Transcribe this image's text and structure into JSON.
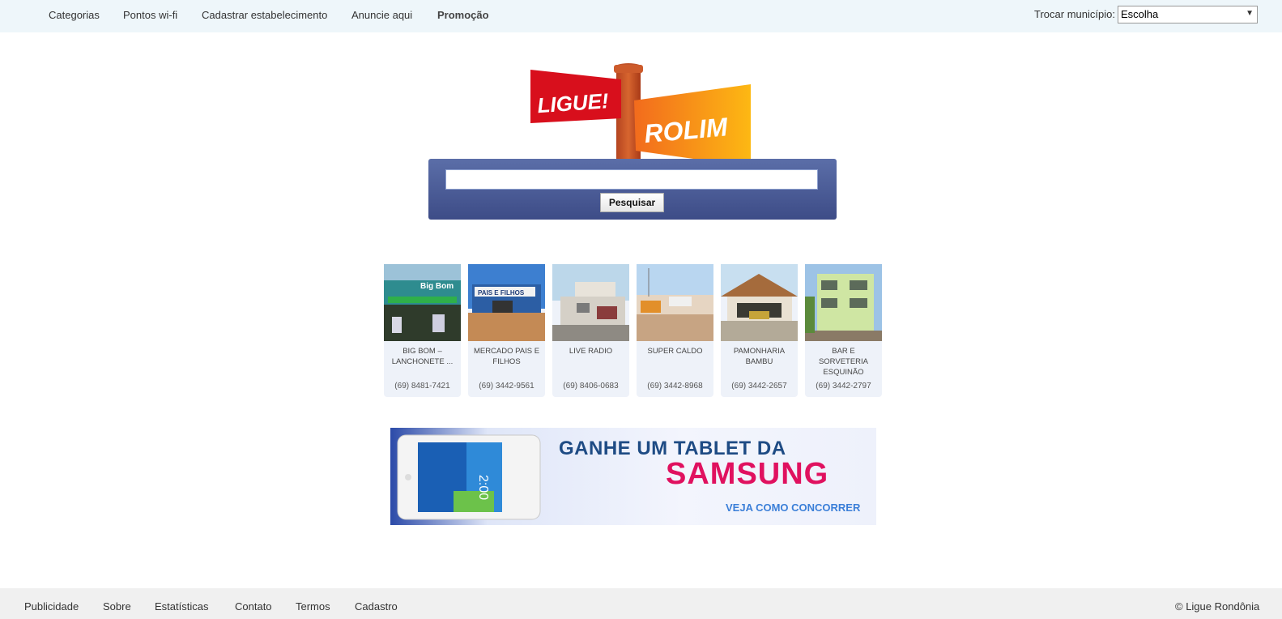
{
  "topnav": {
    "items": [
      "Categorias",
      "Pontos wi-fi",
      "Cadastrar estabelecimento",
      "Anuncie aqui",
      "Promoção"
    ],
    "municipio_label": "Trocar município:",
    "municipio_selected": "Escolha"
  },
  "logo": {
    "word1": "LIGUE!",
    "word2": "ROLIM"
  },
  "search": {
    "value": "",
    "button_label": "Pesquisar"
  },
  "listings": [
    {
      "name": "BIG BOM – LANCHONETE ...",
      "phone": "(69) 8481-7421"
    },
    {
      "name": "MERCADO PAIS E FILHOS",
      "phone": "(69) 3442-9561"
    },
    {
      "name": "LIVE RADIO",
      "phone": "(69) 8406-0683"
    },
    {
      "name": "SUPER CALDO",
      "phone": "(69) 3442-8968"
    },
    {
      "name": "PAMONHARIA BAMBU",
      "phone": "(69) 3442-2657"
    },
    {
      "name": "BAR E SORVETERIA ESQUINÃO",
      "phone": "(69) 3442-2797"
    }
  ],
  "banner": {
    "line1": "GANHE UM TABLET DA",
    "line2": "SAMSUNG",
    "line3": "VEJA COMO CONCORRER",
    "tablet_time": "2:00",
    "storefront_sign_1": "Big Bom",
    "storefront_sign_2": "PAIS E FILHOS"
  },
  "footer": {
    "links": [
      "Publicidade",
      "Sobre",
      "Estatísticas",
      "Contato",
      "Termos",
      "Cadastro"
    ],
    "copyright": "© Ligue Rondônia"
  },
  "colors": {
    "topbar": "#eef6fa",
    "search_panel": "#4a5a96",
    "logo_red": "#d80f1c",
    "logo_orange": "#f7931e",
    "footer": "#f0f0f0"
  }
}
